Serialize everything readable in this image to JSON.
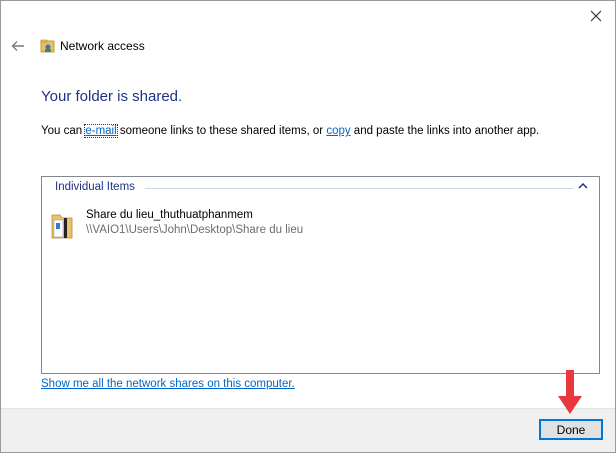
{
  "window": {
    "title": "Network access"
  },
  "heading": "Your folder is shared.",
  "description": {
    "prefix": "You can ",
    "email_link": "e-mail",
    "middle": " someone links to these shared items, or ",
    "copy_link": "copy",
    "suffix": " and paste the links into another app."
  },
  "list": {
    "group_label": "Individual Items",
    "items": [
      {
        "name": "Share du lieu_thuthuatphanmem",
        "path": "\\\\VAIO1\\Users\\John\\Desktop\\Share du lieu"
      }
    ]
  },
  "show_shares_link": "Show me all the network shares on this computer.",
  "footer": {
    "done_label": "Done"
  },
  "colors": {
    "heading": "#1e3287",
    "link": "#0066cc",
    "accent": "#0078d7",
    "annotation_arrow": "#e8383d"
  },
  "icons": [
    "close-icon",
    "back-arrow-icon",
    "network-folder-icon",
    "chevron-up-icon",
    "folder-icon",
    "red-arrow-annotation-icon"
  ]
}
